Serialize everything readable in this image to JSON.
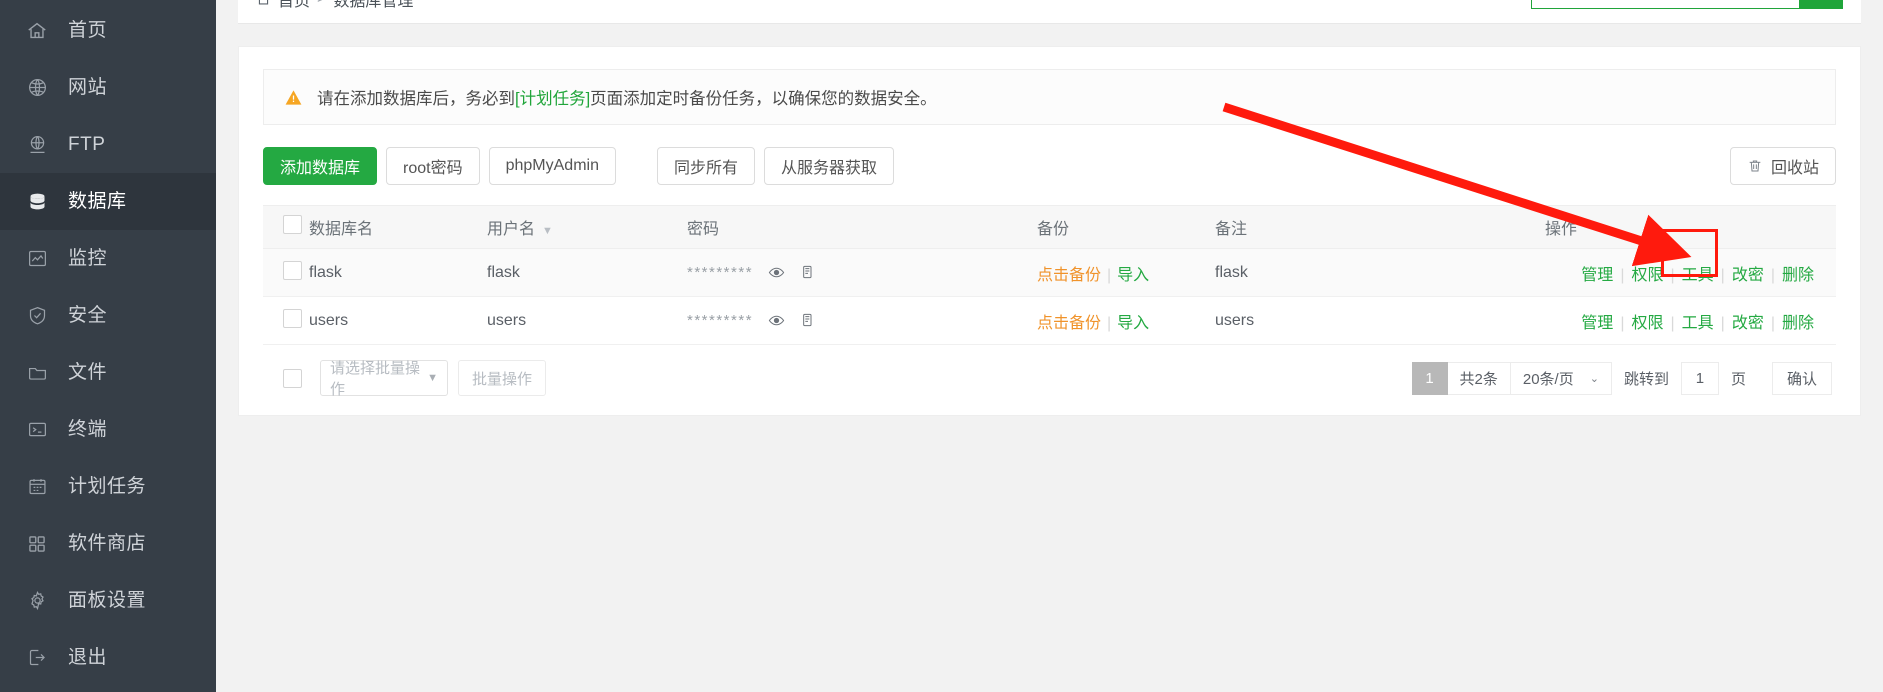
{
  "sidebar": {
    "items": [
      {
        "label": "首页",
        "icon": "home-icon",
        "active": false
      },
      {
        "label": "网站",
        "icon": "globe-icon",
        "active": false
      },
      {
        "label": "FTP",
        "icon": "ftp-icon",
        "active": false
      },
      {
        "label": "数据库",
        "icon": "database-icon",
        "active": true
      },
      {
        "label": "监控",
        "icon": "monitor-icon",
        "active": false
      },
      {
        "label": "安全",
        "icon": "shield-icon",
        "active": false
      },
      {
        "label": "文件",
        "icon": "folder-icon",
        "active": false
      },
      {
        "label": "终端",
        "icon": "terminal-icon",
        "active": false
      },
      {
        "label": "计划任务",
        "icon": "calendar-icon",
        "active": false
      },
      {
        "label": "软件商店",
        "icon": "apps-icon",
        "active": false
      },
      {
        "label": "面板设置",
        "icon": "gear-icon",
        "active": false
      },
      {
        "label": "退出",
        "icon": "logout-icon",
        "active": false
      }
    ]
  },
  "topbar": {
    "breadcrumb_home": "首页",
    "breadcrumb_sep": ">",
    "breadcrumb_current": "数据库管理",
    "search_value": "",
    "search_placeholder": "",
    "search_button_icon": "search-icon"
  },
  "notice": {
    "icon": "warning-icon",
    "text_before": "请在添加数据库后，务必到",
    "link": "[计划任务]",
    "text_after": "页面添加定时备份任务，以确保您的数据安全。"
  },
  "toolbar": {
    "add_db": "添加数据库",
    "root_pwd": "root密码",
    "phpmyadmin": "phpMyAdmin",
    "sync_all": "同步所有",
    "fetch_server": "从服务器获取",
    "recycle_bin": "回收站",
    "recycle_icon": "trash-icon"
  },
  "table": {
    "headers": {
      "db_name": "数据库名",
      "user_name": "用户名",
      "password": "密码",
      "backup": "备份",
      "note": "备注",
      "ops": "操作"
    },
    "sort_indicator": "▼",
    "rows": [
      {
        "db_name": "flask",
        "user_name": "flask",
        "password_mask": "*********",
        "eye_icon": "eye-icon",
        "copy_icon": "copy-icon",
        "backup_link": "点击备份",
        "import_link": "导入",
        "note": "flask",
        "ops": [
          "管理",
          "权限",
          "工具",
          "改密",
          "删除"
        ]
      },
      {
        "db_name": "users",
        "user_name": "users",
        "password_mask": "*********",
        "eye_icon": "eye-icon",
        "copy_icon": "copy-icon",
        "backup_link": "点击备份",
        "import_link": "导入",
        "note": "users",
        "ops": [
          "管理",
          "权限",
          "工具",
          "改密",
          "删除"
        ]
      }
    ]
  },
  "footer": {
    "batch_select_placeholder": "请选择批量操作",
    "batch_button": "批量操作",
    "page_current": "1",
    "total_text": "共2条",
    "page_size": "20条/页",
    "jump_label": "跳转到",
    "jump_value": "1",
    "page_unit": "页",
    "confirm": "确认"
  },
  "annotation": {
    "arrow_color": "#ff1a0d",
    "highlight_target": "权限"
  },
  "colors": {
    "brand_green": "#24a942",
    "sidebar_bg": "#363e47",
    "sidebar_active": "#2e353d",
    "warning_orange": "#f6a623",
    "link_orange": "#f0932b",
    "annotation_red": "#ff1a0d"
  }
}
